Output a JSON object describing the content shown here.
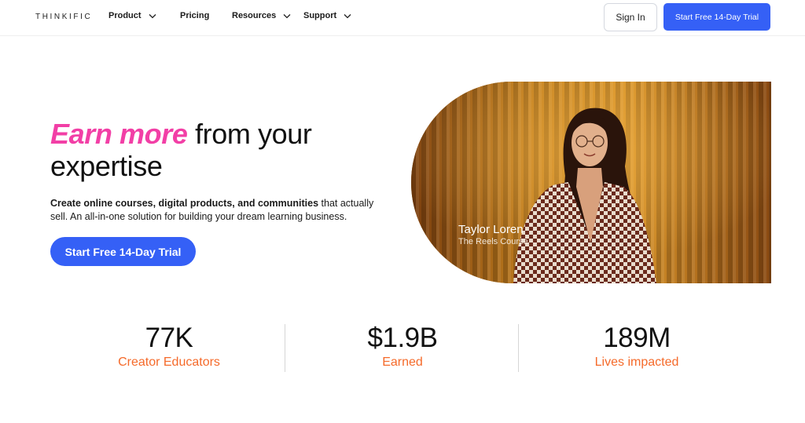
{
  "header": {
    "logo": "THINKIFIC",
    "nav": [
      {
        "label": "Product",
        "has_dropdown": true
      },
      {
        "label": "Pricing",
        "has_dropdown": false
      },
      {
        "label": "Resources",
        "has_dropdown": true
      },
      {
        "label": "Support",
        "has_dropdown": true
      }
    ],
    "sign_in": "Sign In",
    "cta": "Start Free 14-Day Trial"
  },
  "hero": {
    "title_accent": "Earn more",
    "title_rest": "from your expertise",
    "subtitle_bold": "Create online courses, digital products, and communities",
    "subtitle_rest": "that actually sell. An all-in-one solution for building your dream learning business.",
    "cta": "Start Free 14-Day Trial",
    "image": {
      "name": "Taylor Loren",
      "course": "The Reels Course"
    }
  },
  "stats": [
    {
      "value": "77K",
      "label": "Creator Educators"
    },
    {
      "value": "$1.9B",
      "label": "Earned"
    },
    {
      "value": "189M",
      "label": "Lives impacted"
    }
  ],
  "colors": {
    "brand_blue": "#3560f6",
    "accent_pink": "#f23fa6",
    "stat_orange": "#f56a2a"
  }
}
